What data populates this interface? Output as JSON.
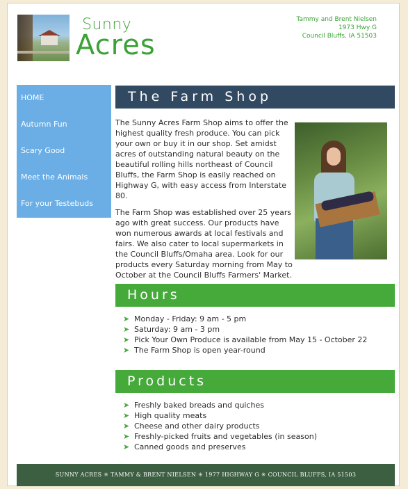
{
  "brand": {
    "line1": "Sunny",
    "line2": "Acres"
  },
  "contact": {
    "names": "Tammy and Brent Nielsen",
    "street": "1973 Hwy G",
    "city": "Council Bluffs, IA  51503"
  },
  "nav": {
    "items": [
      {
        "label": "HOME"
      },
      {
        "label": "Autumn Fun"
      },
      {
        "label": "Scary Good"
      },
      {
        "label": "Meet the Animals"
      },
      {
        "label": "For your Testebuds"
      }
    ]
  },
  "farm_shop": {
    "heading": "The Farm Shop",
    "paragraph1": "The Sunny Acres Farm Shop aims to offer the highest quality fresh produce. You can pick your own or buy it in our shop. Set amidst acres of outstanding natural beauty on the beautiful rolling hills northeast of Council Bluffs, the Farm Shop is easily reached on Highway G, with easy access from Interstate 80.",
    "paragraph2": "The Farm Shop was established over 25 years ago with great success. Our products have won numerous awards at local festivals and fairs. We also cater to local supermarkets in the Council Bluffs/Omaha area. Look for our products every Saturday morning from May to October at the Council Bluffs Farmers' Market."
  },
  "hours": {
    "heading": "Hours",
    "items": [
      "Monday - Friday: 9 am - 5 pm",
      "Saturday: 9 am - 3 pm",
      "Pick Your Own Produce is available from May 15 - October 22",
      "The Farm Shop is open year-round"
    ]
  },
  "products": {
    "heading": "Products",
    "items": [
      "Freshly baked breads and quiches",
      "High quality meats",
      "Cheese and other dairy products",
      "Freshly-picked fruits and vegetables (in season)",
      "Canned goods and preserves"
    ]
  },
  "footer": {
    "text": "SUNNY ACRES ✳ TAMMY & BRENT NIELSEN ✳ 1977 HIGHWAY G ✳ COUNCIL BLUFFS, IA   51503"
  },
  "colors": {
    "green": "#46aa3b",
    "brand_green": "#3ba235",
    "nav_blue": "#6aaee5",
    "heading_navy": "#324962",
    "footer_green": "#3c5e41"
  },
  "icons": {
    "bullet": "arrow-bullet-icon"
  }
}
